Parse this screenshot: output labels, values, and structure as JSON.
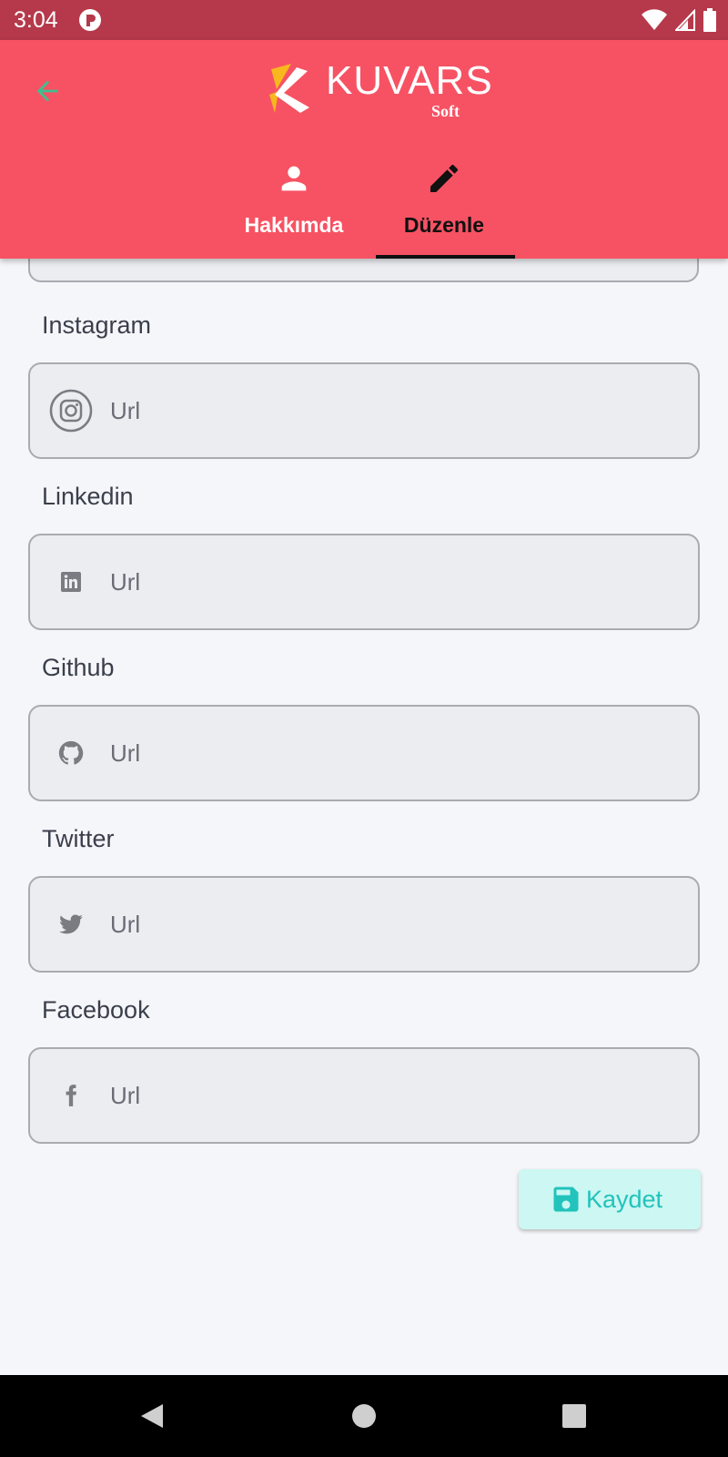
{
  "status_bar": {
    "time": "3:04"
  },
  "header": {
    "logo_brand": "KUVARS",
    "logo_sub": "Soft",
    "tabs": [
      {
        "label": "Hakkımda",
        "icon": "person-icon",
        "active": false
      },
      {
        "label": "Düzenle",
        "icon": "pencil-icon",
        "active": true
      }
    ]
  },
  "form": {
    "fields": [
      {
        "label": "Instagram",
        "placeholder": "Url",
        "icon": "instagram-icon"
      },
      {
        "label": "Linkedin",
        "placeholder": "Url",
        "icon": "linkedin-icon"
      },
      {
        "label": "Github",
        "placeholder": "Url",
        "icon": "github-icon"
      },
      {
        "label": "Twitter",
        "placeholder": "Url",
        "icon": "twitter-icon"
      },
      {
        "label": "Facebook",
        "placeholder": "Url",
        "icon": "facebook-icon"
      }
    ],
    "save_label": "Kaydet"
  },
  "colors": {
    "app_bar": "#f75263",
    "status_bar": "#b5394a",
    "save_text": "#22c3bb",
    "save_bg": "#ccf7f3",
    "back_arrow": "#3fbf8f"
  }
}
